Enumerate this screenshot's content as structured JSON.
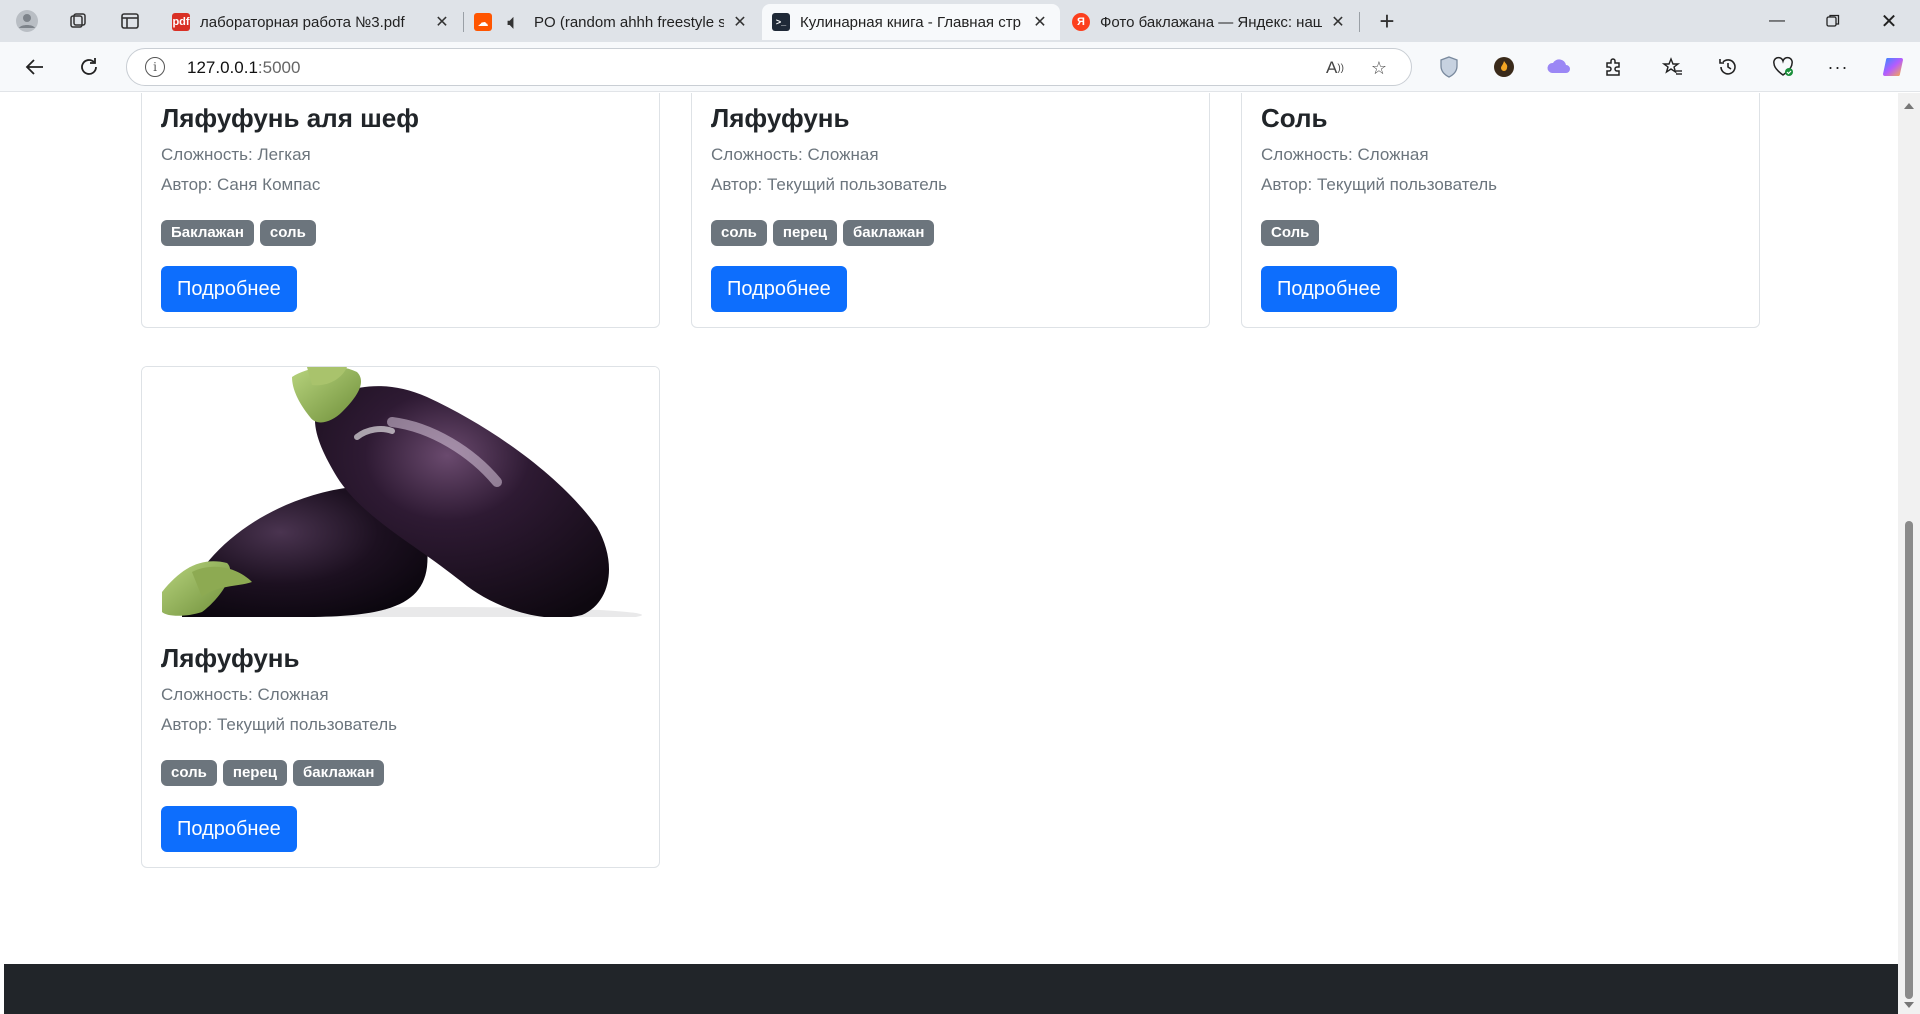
{
  "tabs": [
    {
      "title": "лабораторная работа №3.pdf",
      "favicon": "pdf-icon",
      "active": false
    },
    {
      "title": "PO (random ahhh freestyle st",
      "favicon": "soundcloud-icon",
      "active": false
    },
    {
      "title": "Кулинарная книга - Главная стр",
      "favicon": "terminal-icon",
      "active": true
    },
    {
      "title": "Фото баклажана — Яндекс: наш",
      "favicon": "yandex-icon",
      "active": false
    }
  ],
  "address": {
    "host": "127.0.0.1",
    "port": ":5000"
  },
  "cards": [
    {
      "title": "Ляфуфунь аля шеф",
      "difficulty": "Сложность: Легкая",
      "author": "Автор: Саня Компас",
      "tags": [
        "Баклажан",
        "соль"
      ],
      "button": "Подробнее"
    },
    {
      "title": "Ляфуфунь",
      "difficulty": "Сложность: Сложная",
      "author": "Автор: Текущий пользователь",
      "tags": [
        "соль",
        "перец",
        "баклажан"
      ],
      "button": "Подробнее"
    },
    {
      "title": "Соль",
      "difficulty": "Сложность: Сложная",
      "author": "Автор: Текущий пользователь",
      "tags": [
        "Соль"
      ],
      "button": "Подробнее"
    },
    {
      "title": "Ляфуфунь",
      "difficulty": "Сложность: Сложная",
      "author": "Автор: Текущий пользователь",
      "tags": [
        "соль",
        "перец",
        "баклажан"
      ],
      "button": "Подробнее"
    }
  ],
  "colors": {
    "primary": "#0d6efd",
    "badge": "#6c757d",
    "footer": "#212529"
  }
}
